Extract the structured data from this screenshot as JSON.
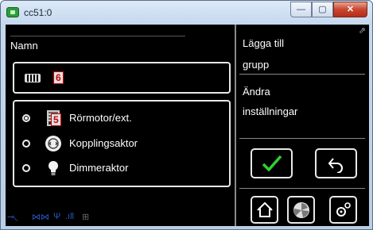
{
  "window": {
    "title": "cc51:0",
    "min_label": "—",
    "max_label": "▢",
    "close_label": "✕"
  },
  "name_section": {
    "label": "Namn",
    "badge": "6"
  },
  "options": [
    {
      "label": "Rörmotor/ext.",
      "selected": true,
      "icon": "roller-motor-icon",
      "badge": "5"
    },
    {
      "label": "Kopplingsaktor",
      "selected": false,
      "icon": "switch-actuator-icon"
    },
    {
      "label": "Dimmeraktor",
      "selected": false,
      "icon": "bulb-icon"
    }
  ],
  "sidebar": {
    "title_line1": "Lägga till",
    "title_line2": "grupp",
    "settings_line1": "Ändra",
    "settings_line2": "inställningar",
    "pin_glyph": "⇗"
  },
  "colors": {
    "accent_green": "#2fd12f",
    "window_frame": "#b9cde6",
    "background": "#000000",
    "status_blue": "#2b57c9"
  },
  "statusbar": {
    "icons": [
      "network-icon",
      "link-icon",
      "antenna-icon",
      "signal-icon",
      "lan-icon"
    ]
  }
}
